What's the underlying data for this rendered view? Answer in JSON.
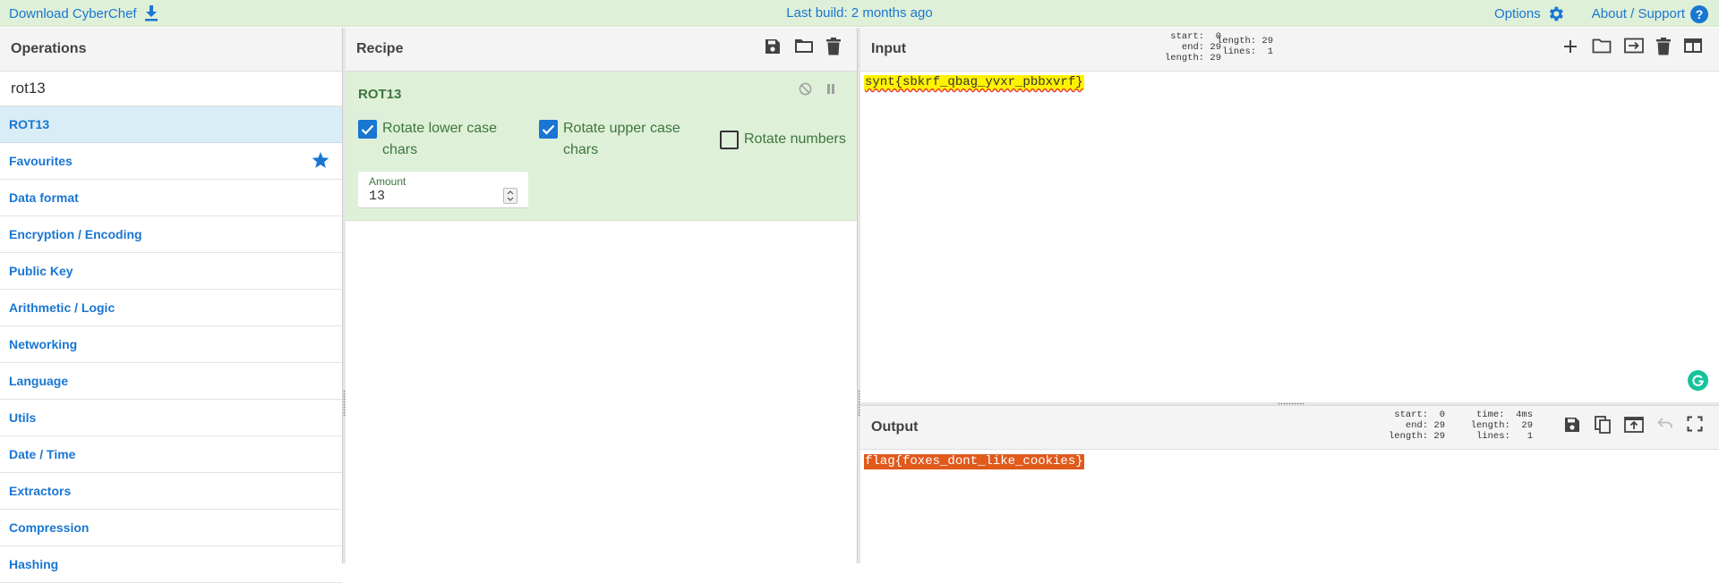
{
  "banner": {
    "download": "Download CyberChef",
    "build": "Last build: 2 months ago",
    "options": "Options",
    "about": "About / Support"
  },
  "operations": {
    "title": "Operations",
    "search_value": "rot13",
    "items": [
      {
        "label": "ROT13"
      },
      {
        "label": "Favourites"
      },
      {
        "label": "Data format"
      },
      {
        "label": "Encryption / Encoding"
      },
      {
        "label": "Public Key"
      },
      {
        "label": "Arithmetic / Logic"
      },
      {
        "label": "Networking"
      },
      {
        "label": "Language"
      },
      {
        "label": "Utils"
      },
      {
        "label": "Date / Time"
      },
      {
        "label": "Extractors"
      },
      {
        "label": "Compression"
      },
      {
        "label": "Hashing"
      }
    ]
  },
  "recipe": {
    "title": "Recipe",
    "operation": {
      "name": "ROT13",
      "options": [
        {
          "label": "Rotate lower case chars",
          "line1": "Rotate lower case",
          "line2": "chars",
          "checked": true
        },
        {
          "label": "Rotate upper case chars",
          "line1": "Rotate upper case",
          "line2": "chars",
          "checked": true
        },
        {
          "label": "Rotate numbers",
          "checked": false
        }
      ],
      "amount_label": "Amount",
      "amount_value": "13"
    }
  },
  "input": {
    "title": "Input",
    "stats_left": "start:  0\nend: 29\nlength: 29",
    "stats_right": "length: 29\nlines:  1",
    "text": "synt{sbkrf_qbag_yvxr_pbbxvrf}"
  },
  "output": {
    "title": "Output",
    "stats_left": "start:  0\nend: 29\nlength: 29",
    "stats_right": "time:  4ms\nlength:  29\nlines:   1",
    "text": "flag{foxes_dont_like_cookies}"
  },
  "colors": {
    "accent": "#1976d2",
    "banner_bg": "#dff0d8",
    "recipe_green": "#3c763d",
    "input_highlight": "#fff200",
    "output_highlight": "#e05a1c"
  }
}
